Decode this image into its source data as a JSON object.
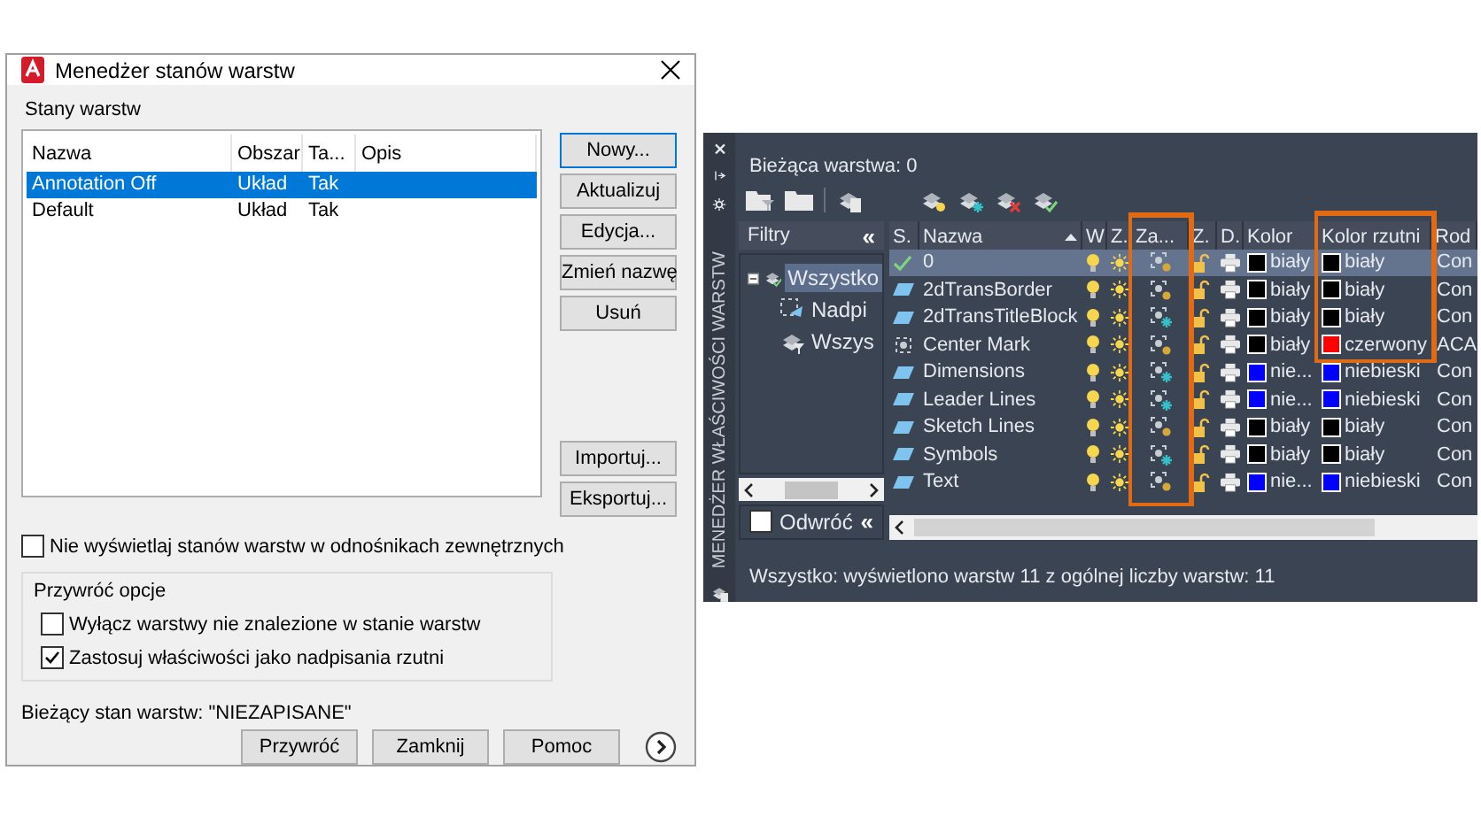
{
  "dialog": {
    "title": "Menedżer stanów warstw",
    "section_label": "Stany warstw",
    "list": {
      "columns": [
        "Nazwa",
        "Obszar",
        "Ta...",
        "Opis"
      ],
      "rows": [
        {
          "cells": [
            "Annotation Off",
            "Układ",
            "Tak"
          ],
          "selected": true
        },
        {
          "cells": [
            "Default",
            "Układ",
            "Tak"
          ],
          "selected": false
        }
      ]
    },
    "side_buttons": [
      "Nowy...",
      "Aktualizuj",
      "Edycja...",
      "Zmień nazwę",
      "Usuń"
    ],
    "side_buttons_lower": [
      "Importuj...",
      "Eksportuj..."
    ],
    "xref_option": {
      "label": "Nie wyświetlaj stanów warstw w odnośnikach zewnętrznych",
      "checked": false
    },
    "restore_options": {
      "title": "Przywróć opcje",
      "options": [
        {
          "label": "Wyłącz warstwy nie znalezione w stanie warstw",
          "checked": false
        },
        {
          "label": "Zastosuj właściwości jako nadpisania rzutni",
          "checked": true
        }
      ]
    },
    "status": "Bieżący stan warstw: \"NIEZAPISANE\"",
    "buttons": [
      "Przywróć",
      "Zamknij",
      "Pomoc"
    ]
  },
  "layer_panel": {
    "palette_title": "MENEDŻER WŁAŚCIWOŚCI WARSTW",
    "current_layer": "Bieżąca warstwa: 0",
    "filters": {
      "title": "Filtry",
      "collapse": "«",
      "tree": [
        {
          "label": "Wszystko",
          "kind": "all",
          "selected": true,
          "expanded": true,
          "children": [
            {
              "label": "Nadpi",
              "kind": "override",
              "selected": false
            },
            {
              "label": "Wszys",
              "kind": "used",
              "selected": false
            }
          ]
        }
      ],
      "invert": {
        "label": "Odwróć",
        "checked": false
      },
      "invert_collapse": "«"
    },
    "table": {
      "columns": [
        "S.",
        "Nazwa",
        "W",
        "Z.",
        "Za...",
        "Z.",
        "D.",
        "Kolor",
        "Kolor rzutni",
        "Rod"
      ],
      "rows": [
        {
          "kind": "current",
          "name": "0",
          "selected": true,
          "vp_frozen": false,
          "layer_color": {
            "name": "biały",
            "color": "#000000"
          },
          "viewport_color": {
            "name": "biały",
            "color": "#000000"
          },
          "linetype": "Con"
        },
        {
          "kind": "layer",
          "name": "2dTransBorder",
          "selected": false,
          "vp_frozen": false,
          "layer_color": {
            "name": "biały",
            "color": "#000000"
          },
          "viewport_color": {
            "name": "biały",
            "color": "#000000"
          },
          "linetype": "Con"
        },
        {
          "kind": "layer",
          "name": "2dTransTitleBlock",
          "selected": false,
          "vp_frozen": true,
          "layer_color": {
            "name": "biały",
            "color": "#000000"
          },
          "viewport_color": {
            "name": "biały",
            "color": "#000000"
          },
          "linetype": "Con"
        },
        {
          "kind": "annotation",
          "name": "Center Mark",
          "selected": false,
          "vp_frozen": false,
          "layer_color": {
            "name": "biały",
            "color": "#000000"
          },
          "viewport_color": {
            "name": "czerwony",
            "color": "#ff0000"
          },
          "linetype": "ACA"
        },
        {
          "kind": "layer",
          "name": "Dimensions",
          "selected": false,
          "vp_frozen": true,
          "layer_color": {
            "name": "nie...",
            "color": "#0000ff"
          },
          "viewport_color": {
            "name": "niebieski",
            "color": "#0000ff"
          },
          "linetype": "Con"
        },
        {
          "kind": "layer",
          "name": "Leader Lines",
          "selected": false,
          "vp_frozen": true,
          "layer_color": {
            "name": "nie...",
            "color": "#0000ff"
          },
          "viewport_color": {
            "name": "niebieski",
            "color": "#0000ff"
          },
          "linetype": "Con"
        },
        {
          "kind": "layer",
          "name": "Sketch Lines",
          "selected": false,
          "vp_frozen": false,
          "layer_color": {
            "name": "biały",
            "color": "#000000"
          },
          "viewport_color": {
            "name": "biały",
            "color": "#000000"
          },
          "linetype": "Con"
        },
        {
          "kind": "layer",
          "name": "Symbols",
          "selected": false,
          "vp_frozen": true,
          "layer_color": {
            "name": "biały",
            "color": "#000000"
          },
          "viewport_color": {
            "name": "biały",
            "color": "#000000"
          },
          "linetype": "Con"
        },
        {
          "kind": "layer",
          "name": "Text",
          "selected": false,
          "vp_frozen": false,
          "layer_color": {
            "name": "nie...",
            "color": "#0000ff"
          },
          "viewport_color": {
            "name": "niebieski",
            "color": "#0000ff"
          },
          "linetype": "Con"
        }
      ]
    },
    "status": "Wszystko: wyświetlono warstw 11 z ogólnej liczby warstw: 11"
  }
}
